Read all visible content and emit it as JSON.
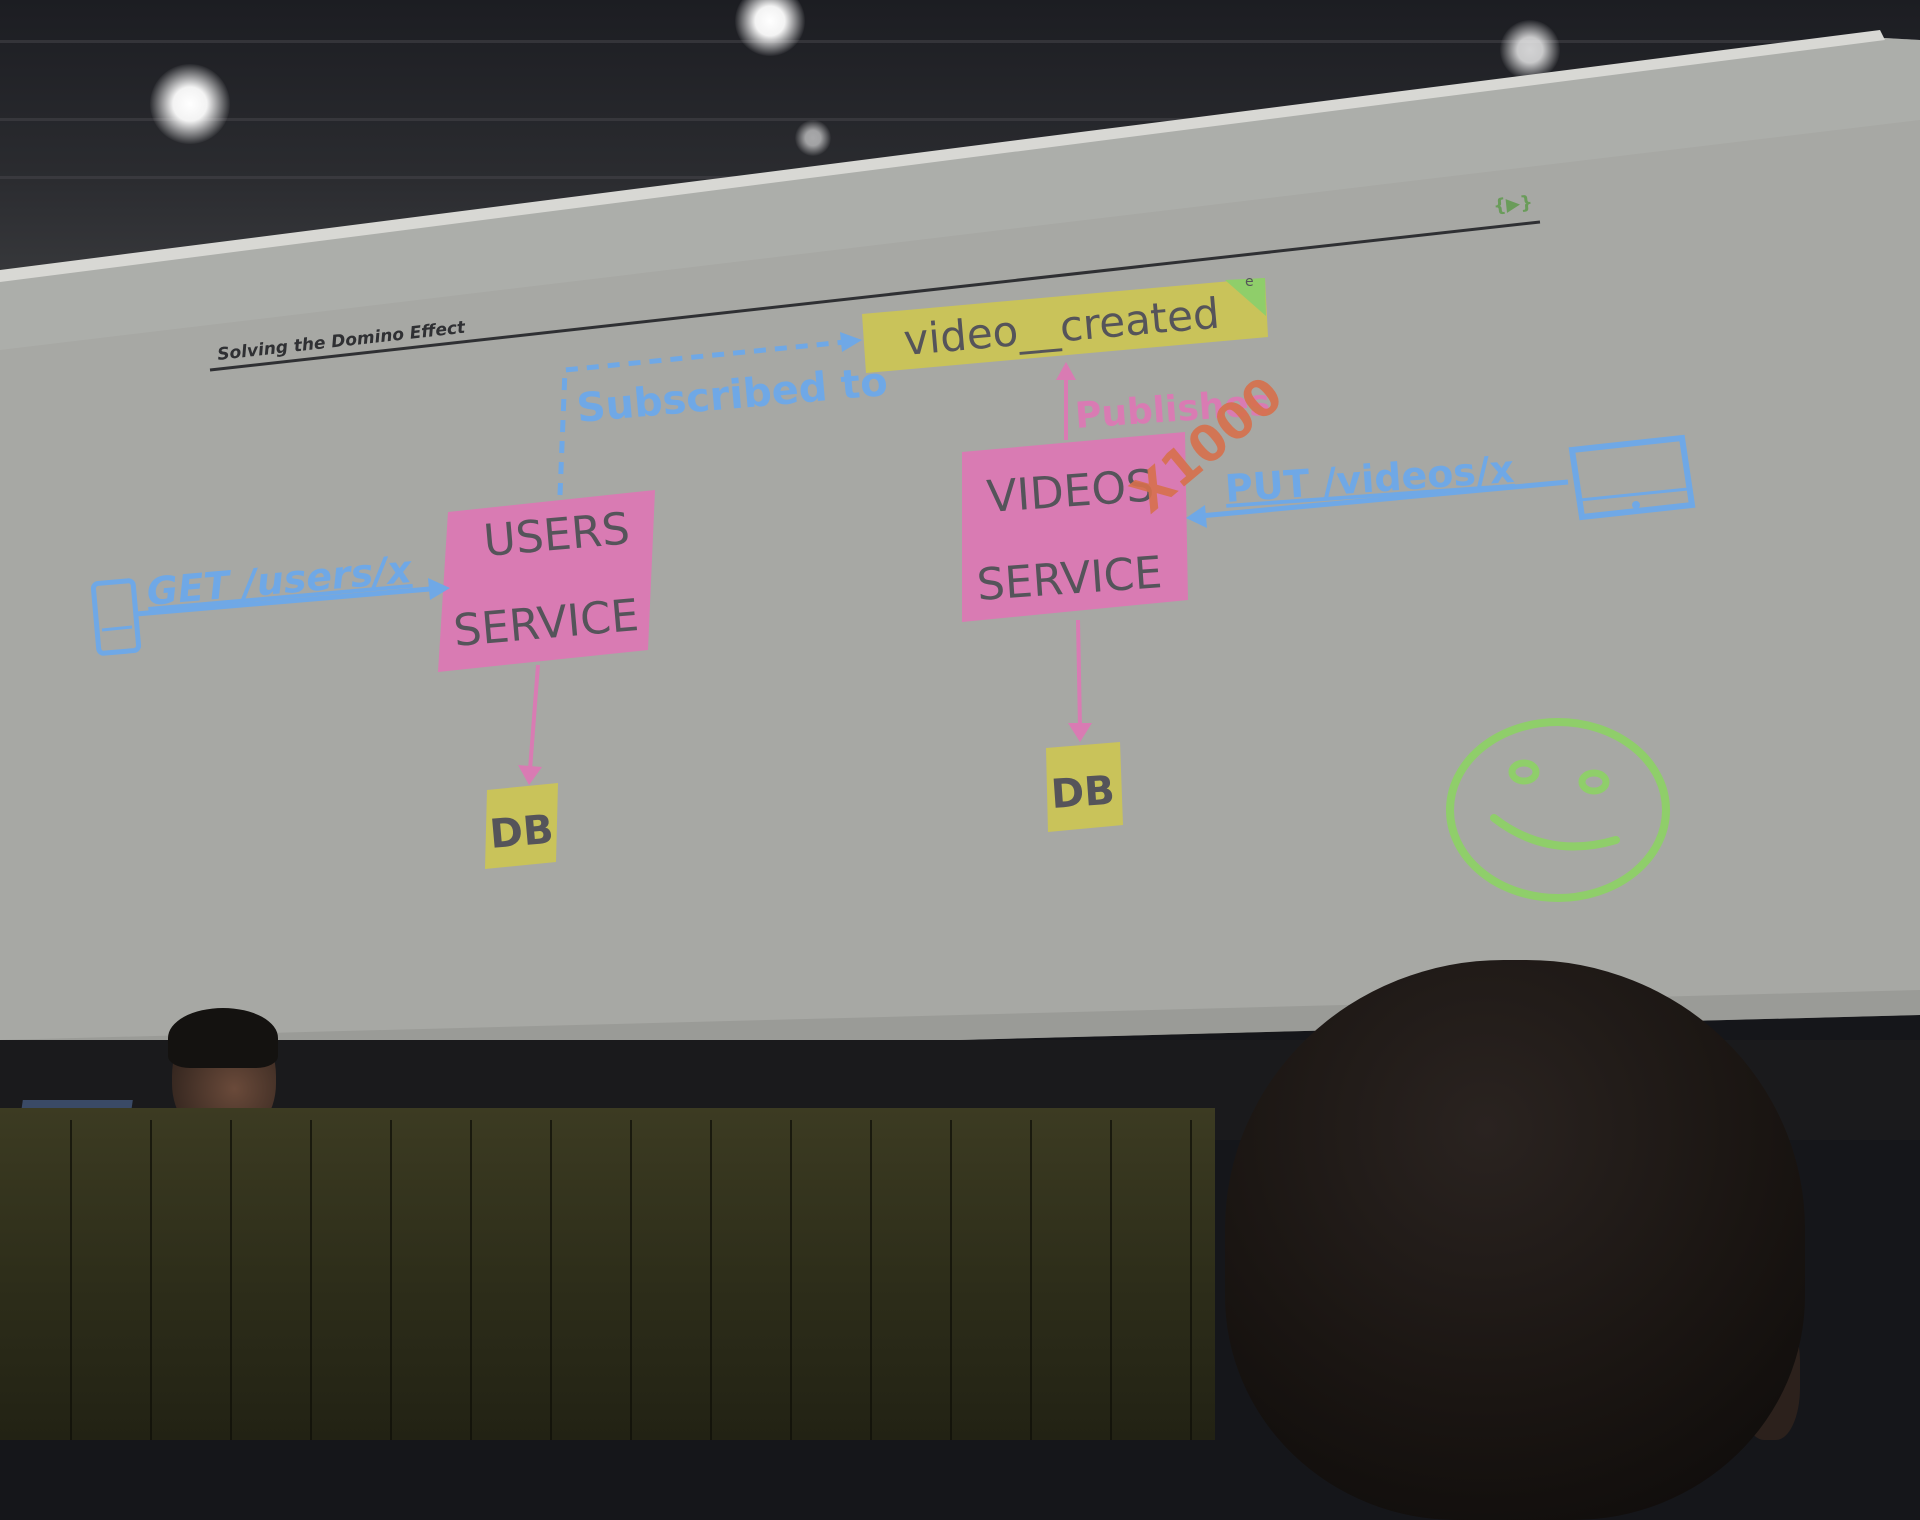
{
  "slide": {
    "title": "Solving the Domino Effect",
    "logo_glyph": "{▶}",
    "colors": {
      "screen": "#a9aaa6",
      "blue": "#6fa8e6",
      "pink": "#d97bb3",
      "yellow": "#c9c35a",
      "green": "#8fce6a",
      "red": "#d7704c",
      "box_text": "#55545a",
      "title_text": "#2f3033"
    },
    "event_box": {
      "label": "video__created",
      "corner_mark": "e"
    },
    "users_service": {
      "line1": "USERS",
      "line2": "SERVICE"
    },
    "videos_service": {
      "line1": "VIDEOS",
      "line2": "SERVICE"
    },
    "users_db": {
      "label": "DB"
    },
    "videos_db": {
      "label": "DB"
    },
    "arrows": {
      "subscribed": "Subscribed to",
      "publishes": "Publishes",
      "multiplier": "X1000",
      "get_request": "GET /users/x",
      "put_request": "PUT /videos/x"
    },
    "icons": {
      "phone": "phone-icon",
      "tablet": "tablet-icon",
      "smiley": "smiley-face-icon"
    }
  }
}
